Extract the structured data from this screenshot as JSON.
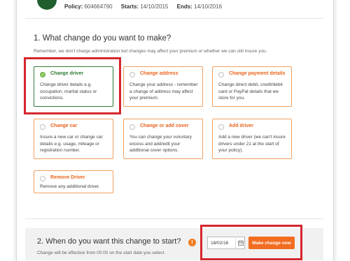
{
  "header": {
    "policy_label": "Policy:",
    "policy_number": "604664790",
    "starts_label": "Starts:",
    "starts_date": "14/10/2015",
    "ends_label": "Ends:",
    "ends_date": "14/10/2016"
  },
  "section1": {
    "title": "1. What change do you want to make?",
    "subtitle": "Remember, we don't charge administration but changes may affect your premium or whether we can still insure you."
  },
  "options": [
    {
      "title": "Change driver",
      "description": "Change driver details e.g. occupation, marital status or convictions.",
      "selected": true
    },
    {
      "title": "Change address",
      "description": "Change your address - remember a change of address may affect your premium.",
      "selected": false
    },
    {
      "title": "Change payment details",
      "description": "Change direct debit, credit/debit card or PayPal details that we store for you.",
      "selected": false
    },
    {
      "title": "Change car",
      "description": "Insure a new car or change car details e.g. usage, mileage or registration number.",
      "selected": false
    },
    {
      "title": "Change or add cover",
      "description": "You can change your voluntary excess and add/edit your additional cover options.",
      "selected": false
    },
    {
      "title": "Add driver",
      "description": "Add a new driver (we can't insure drivers under 21 at the start of your policy).",
      "selected": false
    },
    {
      "title": "Remove Driver",
      "description": "Remove any additional driver.",
      "selected": false
    }
  ],
  "section2": {
    "title": "2. When do you want this change to start?",
    "info_glyph": "!",
    "subtitle": "Change will be effective from 00:00 on the start date you select.",
    "date_value": "18/02/16",
    "button_label": "Make change now"
  },
  "colors": {
    "accent_orange": "#f26d21",
    "selected_green": "#2f7a36",
    "highlight_red": "#d6262e",
    "brand_green": "#1f5f2e"
  }
}
